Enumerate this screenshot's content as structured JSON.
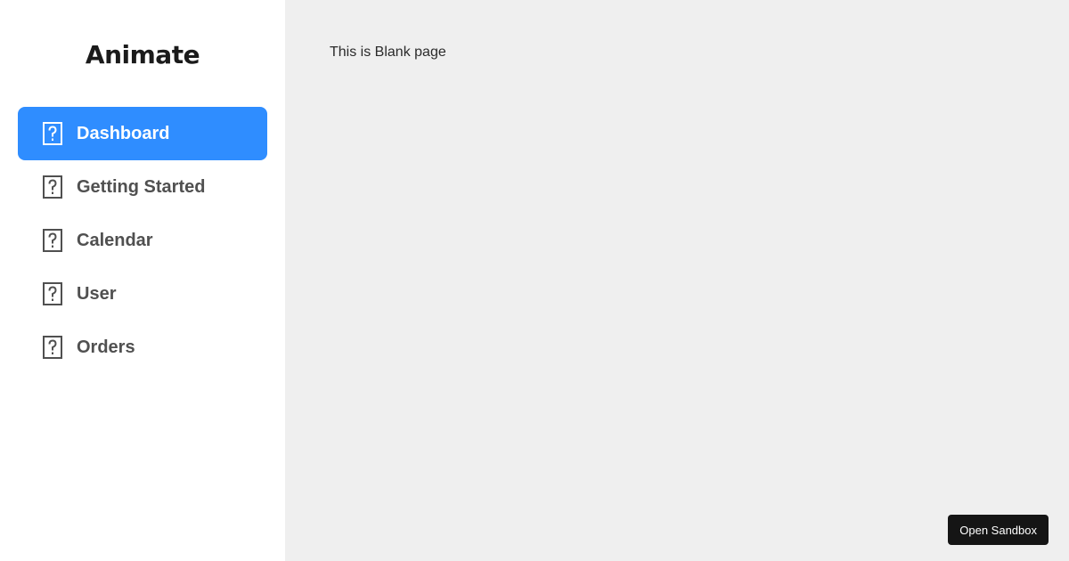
{
  "sidebar": {
    "logo": "Animate",
    "items": [
      {
        "label": "Dashboard",
        "icon": "help-icon",
        "active": true
      },
      {
        "label": "Getting Started",
        "icon": "help-icon",
        "active": false
      },
      {
        "label": "Calendar",
        "icon": "help-icon",
        "active": false
      },
      {
        "label": "User",
        "icon": "help-icon",
        "active": false
      },
      {
        "label": "Orders",
        "icon": "help-icon",
        "active": false
      }
    ]
  },
  "main": {
    "text": "This is Blank page"
  },
  "sandbox": {
    "label": "Open Sandbox"
  },
  "colors": {
    "accent": "#2f8dff",
    "sidebar_bg": "#ffffff",
    "main_bg": "#efefef",
    "button_bg": "#151515"
  }
}
